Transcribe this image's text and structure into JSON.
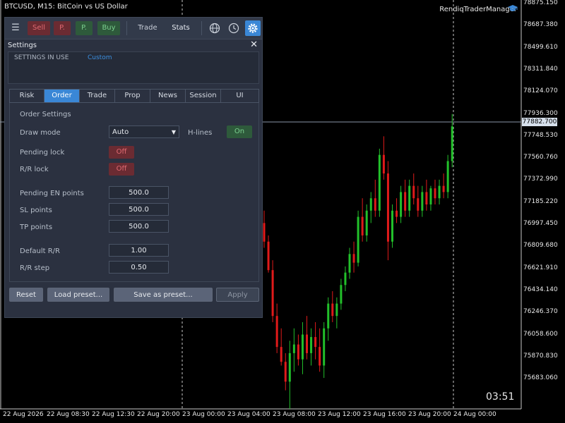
{
  "chart": {
    "title": "BTCUSD, M15:  BitCoin vs US Dollar",
    "manager_label": "RendiqTraderManager",
    "timer": "03:51",
    "current_price": "77882.700",
    "y_labels": [
      "78875.150",
      "78687.380",
      "78499.610",
      "78311.840",
      "78124.070",
      "77936.300",
      "77748.530",
      "77560.760",
      "77372.990",
      "77185.220",
      "76997.450",
      "76809.680",
      "76621.910",
      "76434.140",
      "76246.370",
      "76058.600",
      "75870.830",
      "75683.060"
    ],
    "x_labels": [
      "22 Aug 2026",
      "22 Aug 08:30",
      "22 Aug 12:30",
      "22 Aug 20:00",
      "23 Aug 00:00",
      "23 Aug 04:00",
      "23 Aug 08:00",
      "23 Aug 12:00",
      "23 Aug 16:00",
      "23 Aug 20:00",
      "24 Aug 00:00"
    ],
    "up_color": "#22c02a",
    "down_color": "#e01a1a",
    "bg_color": "#000000"
  },
  "chart_data": {
    "type": "candlestick",
    "ylim": [
      75600,
      78900
    ],
    "candles": [
      {
        "o": 77100,
        "h": 77200,
        "l": 76900,
        "c": 76950
      },
      {
        "o": 76950,
        "h": 77000,
        "l": 76700,
        "c": 76720
      },
      {
        "o": 76720,
        "h": 76800,
        "l": 76300,
        "c": 76350
      },
      {
        "o": 76350,
        "h": 76450,
        "l": 76050,
        "c": 76100
      },
      {
        "o": 76100,
        "h": 76250,
        "l": 75950,
        "c": 75980
      },
      {
        "o": 75980,
        "h": 76050,
        "l": 75750,
        "c": 75820
      },
      {
        "o": 75820,
        "h": 76150,
        "l": 75600,
        "c": 76050
      },
      {
        "o": 76050,
        "h": 76250,
        "l": 75900,
        "c": 76120
      },
      {
        "o": 76120,
        "h": 76200,
        "l": 75950,
        "c": 76000
      },
      {
        "o": 76000,
        "h": 76300,
        "l": 75880,
        "c": 76200
      },
      {
        "o": 76200,
        "h": 76350,
        "l": 76000,
        "c": 76050
      },
      {
        "o": 76050,
        "h": 76250,
        "l": 75950,
        "c": 76180
      },
      {
        "o": 76180,
        "h": 76300,
        "l": 76000,
        "c": 76100
      },
      {
        "o": 76100,
        "h": 76250,
        "l": 75900,
        "c": 75950
      },
      {
        "o": 75950,
        "h": 76300,
        "l": 75850,
        "c": 76250
      },
      {
        "o": 76250,
        "h": 76500,
        "l": 76150,
        "c": 76450
      },
      {
        "o": 76450,
        "h": 76550,
        "l": 76300,
        "c": 76350
      },
      {
        "o": 76350,
        "h": 76500,
        "l": 76250,
        "c": 76450
      },
      {
        "o": 76450,
        "h": 76650,
        "l": 76400,
        "c": 76600
      },
      {
        "o": 76600,
        "h": 76750,
        "l": 76550,
        "c": 76700
      },
      {
        "o": 76700,
        "h": 76900,
        "l": 76650,
        "c": 76850
      },
      {
        "o": 76850,
        "h": 76950,
        "l": 76700,
        "c": 76780
      },
      {
        "o": 76780,
        "h": 77200,
        "l": 76750,
        "c": 77150
      },
      {
        "o": 77150,
        "h": 77300,
        "l": 76950,
        "c": 77000
      },
      {
        "o": 77000,
        "h": 77250,
        "l": 76950,
        "c": 77200
      },
      {
        "o": 77200,
        "h": 77350,
        "l": 77100,
        "c": 77300
      },
      {
        "o": 77300,
        "h": 77450,
        "l": 77150,
        "c": 77200
      },
      {
        "o": 77200,
        "h": 77700,
        "l": 77150,
        "c": 77650
      },
      {
        "o": 77650,
        "h": 77800,
        "l": 77450,
        "c": 77500
      },
      {
        "o": 77500,
        "h": 77600,
        "l": 76800,
        "c": 76950
      },
      {
        "o": 76950,
        "h": 77250,
        "l": 76900,
        "c": 77200
      },
      {
        "o": 77200,
        "h": 77300,
        "l": 77100,
        "c": 77150
      },
      {
        "o": 77150,
        "h": 77400,
        "l": 77100,
        "c": 77350
      },
      {
        "o": 77350,
        "h": 77450,
        "l": 77150,
        "c": 77200
      },
      {
        "o": 77200,
        "h": 77450,
        "l": 77150,
        "c": 77400
      },
      {
        "o": 77400,
        "h": 77500,
        "l": 77250,
        "c": 77300
      },
      {
        "o": 77300,
        "h": 77400,
        "l": 77150,
        "c": 77200
      },
      {
        "o": 77200,
        "h": 77400,
        "l": 77150,
        "c": 77350
      },
      {
        "o": 77350,
        "h": 77450,
        "l": 77200,
        "c": 77250
      },
      {
        "o": 77250,
        "h": 77400,
        "l": 77200,
        "c": 77380
      },
      {
        "o": 77380,
        "h": 77450,
        "l": 77250,
        "c": 77300
      },
      {
        "o": 77300,
        "h": 77450,
        "l": 77250,
        "c": 77400
      },
      {
        "o": 77400,
        "h": 77500,
        "l": 77300,
        "c": 77350
      },
      {
        "o": 77350,
        "h": 77650,
        "l": 77300,
        "c": 77600
      },
      {
        "o": 77600,
        "h": 77980,
        "l": 77550,
        "c": 77880
      }
    ]
  },
  "toolbar": {
    "sell": "Sell",
    "p1": "P.",
    "p2": "P.",
    "buy": "Buy",
    "trade": "Trade",
    "stats": "Stats",
    "menu_glyph": "☰"
  },
  "panel": {
    "title": "Settings",
    "close_glyph": "✕",
    "settings_in_use_label": "SETTINGS IN USE",
    "settings_in_use_value": "Custom"
  },
  "tabs": [
    "Risk",
    "Order",
    "Trade",
    "Prop",
    "News",
    "Session",
    "UI"
  ],
  "active_tab": "Order",
  "order": {
    "section_title": "Order Settings",
    "draw_mode_label": "Draw mode",
    "draw_mode_value": "Auto",
    "hlines_label": "H-lines",
    "hlines_value": "On",
    "pending_lock_label": "Pending lock",
    "pending_lock_value": "Off",
    "rr_lock_label": "R/R lock",
    "rr_lock_value": "Off",
    "pending_en_label": "Pending EN points",
    "pending_en_value": "500.0",
    "sl_label": "SL points",
    "sl_value": "500.0",
    "tp_label": "TP points",
    "tp_value": "500.0",
    "default_rr_label": "Default R/R",
    "default_rr_value": "1.00",
    "rr_step_label": "R/R step",
    "rr_step_value": "0.50"
  },
  "actions": {
    "reset": "Reset",
    "load": "Load preset...",
    "save": "Save as preset...",
    "apply": "Apply"
  }
}
